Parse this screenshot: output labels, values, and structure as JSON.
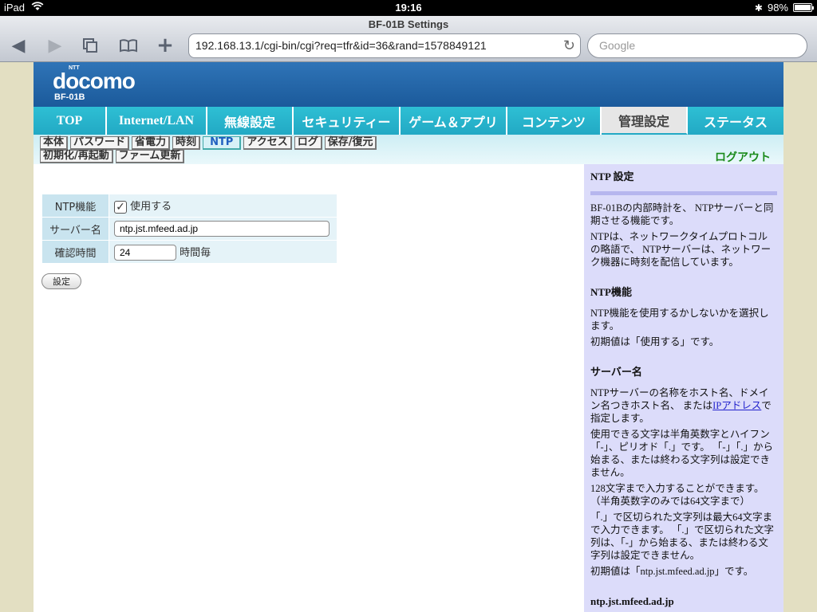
{
  "status_bar": {
    "device": "iPad",
    "time": "19:16",
    "battery": "98%",
    "battery_level": 0.98
  },
  "browser": {
    "title": "BF-01B Settings",
    "url": "192.168.13.1/cgi-bin/cgi?req=tfr&id=36&rand=1578849121",
    "search_placeholder": "Google"
  },
  "header": {
    "logo": "docomo",
    "logo_small": "NTT",
    "model": "BF-01B"
  },
  "main_tabs": [
    "TOP",
    "Internet/LAN",
    "無線設定",
    "セキュリティー",
    "ゲーム＆アプリ",
    "コンテンツ",
    "管理設定",
    "ステータス"
  ],
  "sub_tabs_row1": [
    "本体",
    "パスワード",
    "省電力",
    "時刻",
    "NTP",
    "アクセス",
    "ログ",
    "保存/復元"
  ],
  "sub_tabs_row2": [
    "初期化/再起動",
    "ファーム更新"
  ],
  "logout": "ログアウト",
  "form": {
    "ntp_label": "NTP機能",
    "ntp_use_label": "使用する",
    "server_label": "サーバー名",
    "server_value": "ntp.jst.mfeed.ad.jp",
    "interval_label": "確認時間",
    "interval_value": "24",
    "interval_unit": "時間毎",
    "submit": "設定"
  },
  "help": {
    "title": "NTP 設定",
    "intro": [
      "BF-01Bの内部時計を、 NTPサーバーと同期させる機能です。",
      "NTPは、ネットワークタイムプロトコルの略語で、 NTPサーバーは、ネットワーク機器に時刻を配信しています。"
    ],
    "ntp_title": "NTP機能",
    "ntp_text": [
      "NTP機能を使用するかしないかを選択します。",
      "初期値は「使用する」です。"
    ],
    "server_title": "サーバー名",
    "server_text_pre": "NTPサーバーの名称をホスト名、ドメイン名つきホスト名、 または",
    "server_link": "IPアドレス",
    "server_text_post": "で指定します。",
    "server_text": [
      "使用できる文字は半角英数字とハイフン「-」、ピリオド「.」です。 「-」「.」から始まる、または終わる文字列は設定できません。",
      "128文字まで入力することができます。（半角英数字のみでは64文字まで）",
      "「.」で区切られた文字列は最大64文字まで入力できます。 「.」で区切られた文字列は、「-」から始まる、または終わる文字列は設定できません。",
      "初期値は「ntp.jst.mfeed.ad.jp」です。"
    ],
    "footer": "ntp.jst.mfeed.ad.jp"
  }
}
